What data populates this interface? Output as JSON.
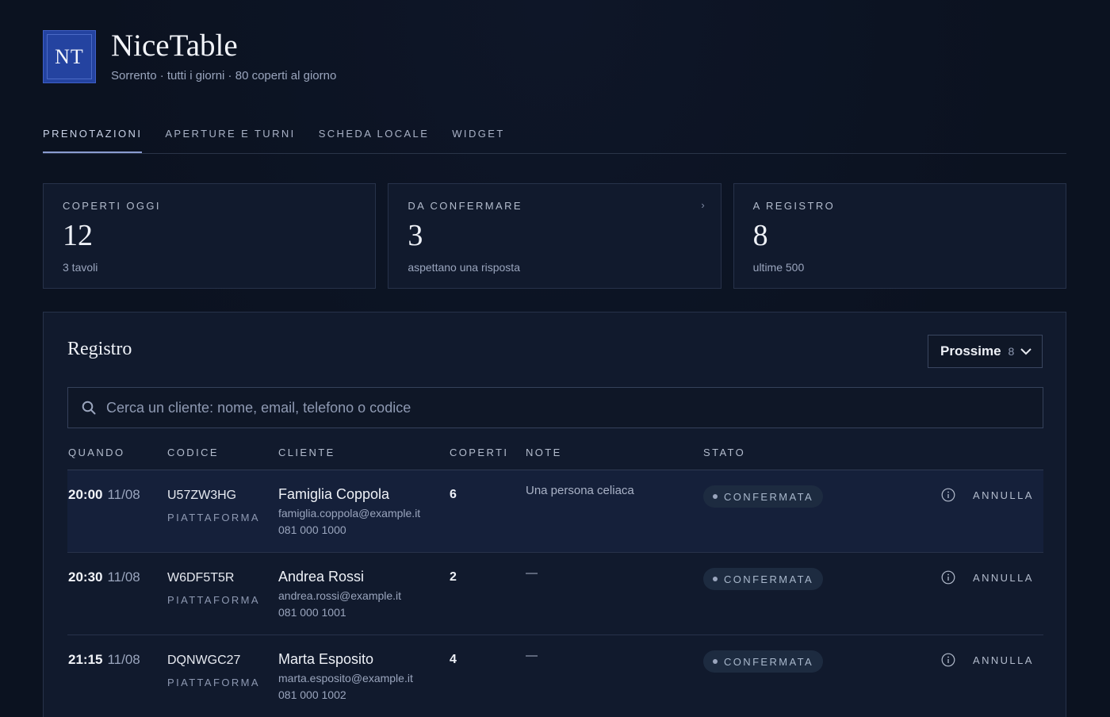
{
  "brand": {
    "logo_text": "NT",
    "name": "NiceTable",
    "subtitle": "Sorrento · tutti i giorni · 80 coperti al giorno"
  },
  "tabs": [
    {
      "label": "PRENOTAZIONI",
      "active": true
    },
    {
      "label": "APERTURE E TURNI",
      "active": false
    },
    {
      "label": "SCHEDA LOCALE",
      "active": false
    },
    {
      "label": "WIDGET",
      "active": false
    }
  ],
  "stats": [
    {
      "label": "COPERTI OGGI",
      "value": "12",
      "sub": "3 tavoli"
    },
    {
      "label": "DA CONFERMARE",
      "value": "3",
      "sub": "aspettano una risposta",
      "chevron": "›"
    },
    {
      "label": "A REGISTRO",
      "value": "8",
      "sub": "ultime 500"
    }
  ],
  "registry": {
    "title": "Registro",
    "filter": {
      "label": "Prossime",
      "count": "8",
      "icon": "chevron-down-icon"
    },
    "search": {
      "placeholder": "Cerca un cliente: nome, email, telefono o codice",
      "value": "",
      "icon": "search-icon"
    },
    "columns": [
      "QUANDO",
      "CODICE",
      "CLIENTE",
      "COPERTI",
      "NOTE",
      "STATO"
    ],
    "rows": [
      {
        "time": "20:00",
        "date": "11/08",
        "code": "U57ZW3HG",
        "source": "PIATTAFORMA",
        "name": "Famiglia Coppola",
        "email": "famiglia.coppola@example.it",
        "phone": "081 000 1000",
        "covers": "6",
        "note": "Una persona celiaca",
        "status": "CONFERMATA",
        "action": "ANNULLA",
        "highlighted": true
      },
      {
        "time": "20:30",
        "date": "11/08",
        "code": "W6DF5T5R",
        "source": "PIATTAFORMA",
        "name": "Andrea Rossi",
        "email": "andrea.rossi@example.it",
        "phone": "081 000 1001",
        "covers": "2",
        "note": "—",
        "status": "CONFERMATA",
        "action": "ANNULLA",
        "highlighted": false
      },
      {
        "time": "21:15",
        "date": "11/08",
        "code": "DQNWGC27",
        "source": "PIATTAFORMA",
        "name": "Marta Esposito",
        "email": "marta.esposito@example.it",
        "phone": "081 000 1002",
        "covers": "4",
        "note": "—",
        "status": "CONFERMATA",
        "action": "ANNULLA",
        "highlighted": false
      }
    ]
  },
  "colors": {
    "accent": "#2443a0",
    "background": "#0b1220",
    "panel": "#111a2d"
  }
}
